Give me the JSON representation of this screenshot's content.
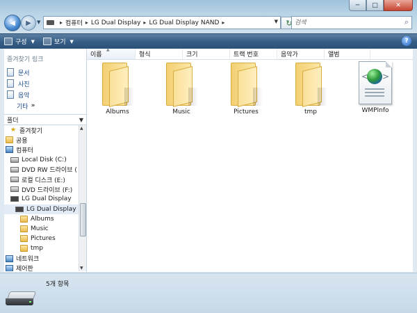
{
  "window": {
    "minimize": "─",
    "maximize": "□",
    "close": "✕"
  },
  "nav": {
    "breadcrumb": [
      "컴퓨터",
      "LG Dual Display",
      "LG Dual Display NAND"
    ],
    "separator": "▸",
    "search_placeholder": "검색"
  },
  "toolbar": {
    "organize": "구성",
    "views": "보기",
    "help": "?"
  },
  "favorites": {
    "title": "즐겨찾기 링크",
    "items": [
      "문서",
      "사진",
      "음악"
    ],
    "more": "기타",
    "more_glyph": "»"
  },
  "folders": {
    "header": "폴더",
    "tree": [
      {
        "label": "즐겨찾기",
        "icon": "star-icon",
        "indent": 1
      },
      {
        "label": "공용",
        "icon": "folder-icon",
        "indent": 0
      },
      {
        "label": "컴퓨터",
        "icon": "computer-icon",
        "indent": 0
      },
      {
        "label": "Local Disk (C:)",
        "icon": "drive-icon",
        "indent": 1
      },
      {
        "label": "DVD RW 드라이브 (",
        "icon": "dvd-drive-icon",
        "indent": 1
      },
      {
        "label": "로컬 디스크 (E:)",
        "icon": "drive-icon",
        "indent": 1
      },
      {
        "label": "DVD 드라이브 (F:)",
        "icon": "dvd-drive-icon",
        "indent": 1
      },
      {
        "label": "LG Dual Display",
        "icon": "device-icon",
        "indent": 1
      },
      {
        "label": "LG Dual Display N",
        "icon": "device-icon",
        "indent": 2,
        "selected": true
      },
      {
        "label": "Albums",
        "icon": "folder-icon",
        "indent": 3
      },
      {
        "label": "Music",
        "icon": "folder-icon",
        "indent": 3
      },
      {
        "label": "Pictures",
        "icon": "folder-icon",
        "indent": 3
      },
      {
        "label": "tmp",
        "icon": "folder-icon",
        "indent": 3
      },
      {
        "label": "네트워크",
        "icon": "network-icon",
        "indent": 0
      },
      {
        "label": "제어판",
        "icon": "control-panel-icon",
        "indent": 0
      }
    ]
  },
  "columns": [
    "이름",
    "형식",
    "크기",
    "트랙 번호",
    "음악가",
    "앨범"
  ],
  "items": [
    {
      "name": "Albums",
      "type": "folder"
    },
    {
      "name": "Music",
      "type": "folder"
    },
    {
      "name": "Pictures",
      "type": "folder"
    },
    {
      "name": "tmp",
      "type": "folder"
    },
    {
      "name": "WMPInfo",
      "type": "xml-file"
    }
  ],
  "status": {
    "count": "5개 항목"
  }
}
